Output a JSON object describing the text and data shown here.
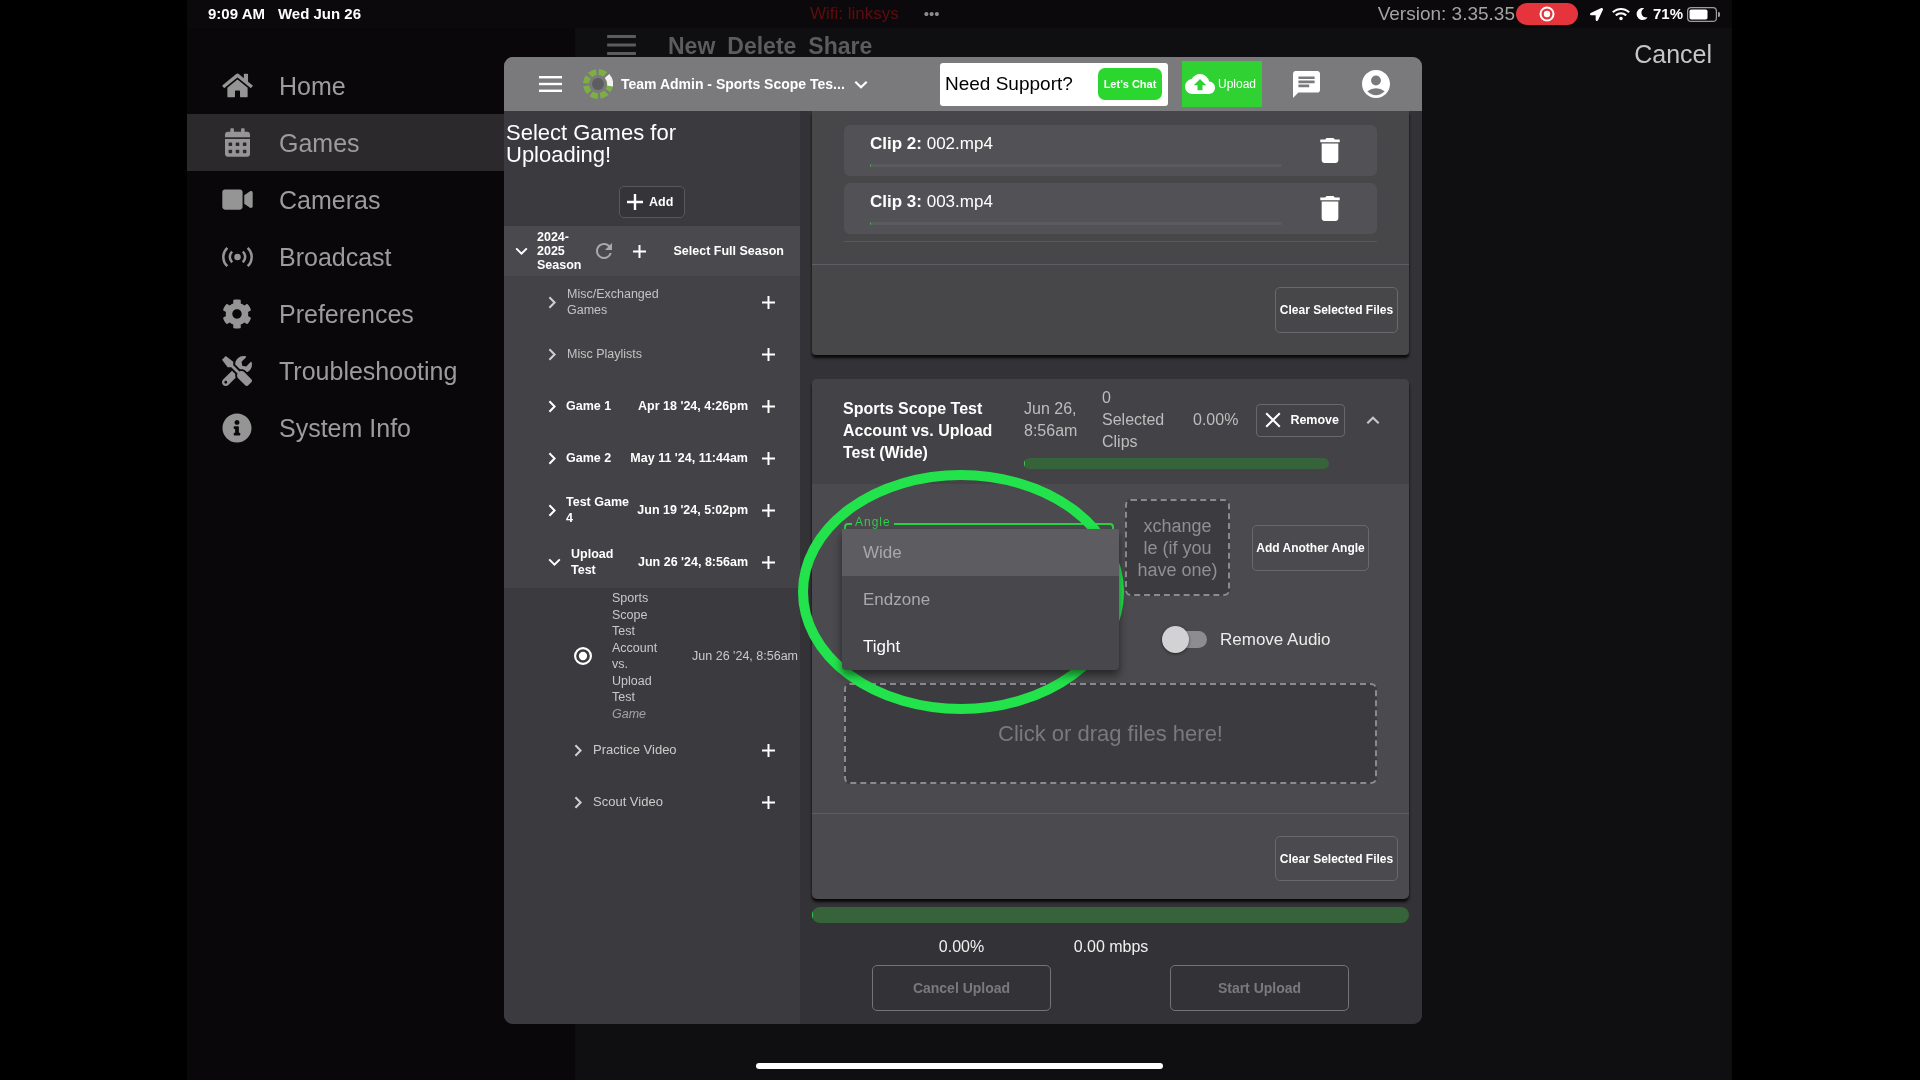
{
  "status_bar": {
    "time": "9:09 AM",
    "date": "Wed Jun 26",
    "wifi": "Wifi: linksys",
    "more": "•••",
    "version": "Version: 3.35.35",
    "battery": "71%"
  },
  "background_toolbar": {
    "actions": [
      "New",
      "Delete",
      "Share"
    ],
    "cancel": "Cancel"
  },
  "sidebar": {
    "items": [
      {
        "label": "Home",
        "selected": false
      },
      {
        "label": "Games",
        "selected": true
      },
      {
        "label": "Cameras",
        "selected": false
      },
      {
        "label": "Broadcast",
        "selected": false
      },
      {
        "label": "Preferences",
        "selected": false
      },
      {
        "label": "Troubleshooting",
        "selected": false
      },
      {
        "label": "System Info",
        "selected": false
      }
    ]
  },
  "dialog": {
    "header": {
      "title": "Team Admin - Sports Scope Tes...",
      "support": "Need Support?",
      "chat_button": "Let's Chat",
      "upload_button": "Upload"
    },
    "game_picker": {
      "title": "Select Games for Uploading!",
      "add_button": "Add",
      "season": {
        "label": "2024-2025 Season",
        "expanded": true,
        "select_all": "Select Full Season",
        "children": [
          {
            "kind": "folder",
            "label": "Misc/Exchanged Games",
            "expanded": false
          },
          {
            "kind": "folder",
            "label": "Misc Playlists",
            "expanded": false
          },
          {
            "kind": "game",
            "label": "Game 1",
            "date": "Apr 18 '24, 4:26pm",
            "expanded": false
          },
          {
            "kind": "game",
            "label": "Game 2",
            "date": "May 11 '24, 11:44am",
            "expanded": false
          },
          {
            "kind": "game",
            "label": "Test Game 4",
            "date": "Jun 19 '24, 5:02pm",
            "expanded": false
          },
          {
            "kind": "game",
            "label": "Upload Test",
            "date": "Jun 26 '24, 8:56am",
            "expanded": true,
            "children": [
              {
                "kind": "video",
                "label": "Sports Scope Test Account vs. Upload Test",
                "type": "Game",
                "date": "Jun 26 '24, 8:56am",
                "selected": true
              },
              {
                "kind": "folder",
                "label": "Practice Video",
                "expanded": false
              },
              {
                "kind": "folder",
                "label": "Scout Video",
                "expanded": false
              }
            ]
          }
        ]
      }
    },
    "clips_card": {
      "clips": [
        {
          "label": "**Clip 2:** 002.mp4",
          "level": 0
        },
        {
          "label": "**Clip 3:** 003.mp4",
          "level": 0
        }
      ],
      "clear_button": "Clear Selected Files"
    },
    "angle_card": {
      "title": "Sports Scope Test Account vs. Upload Test (Wide)",
      "date": "Jun 26, 8:56am",
      "selected_clips": "0 Selected Clips",
      "percent": "0.00%",
      "remove_button": "Remove",
      "expanded": true,
      "level": 0,
      "angle_field": {
        "label": "Angle",
        "open": true,
        "options": [
          {
            "label": "Wide",
            "selected": true,
            "disabled": true
          },
          {
            "label": "Endzone",
            "selected": false,
            "disabled": true
          },
          {
            "label": "Tight",
            "selected": false,
            "disabled": false
          }
        ]
      },
      "exchange_box": {
        "lines": [
          "xchange",
          "le (if you",
          "have one)"
        ]
      },
      "add_angle_button": "Add Another Angle",
      "remove_audio": {
        "label": "Remove Audio",
        "on": false
      },
      "drop_zone": {
        "placeholder": "Click or drag files here!"
      },
      "clear_button": "Clear Selected Files"
    },
    "upload": {
      "level": 0,
      "percent": "0.00%",
      "speed": "0.00 mbps",
      "cancel_button": {
        "label": "Cancel Upload",
        "disabled": true
      },
      "start_button": {
        "label": "Start Upload",
        "disabled": true
      }
    }
  }
}
